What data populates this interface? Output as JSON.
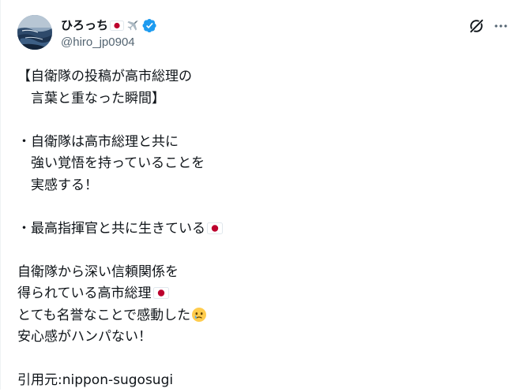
{
  "author": {
    "display_name": "ひろっち",
    "handle": "@hiro_jp0904",
    "verified": true,
    "name_emojis": [
      "flag-japan-icon",
      "airplane-icon"
    ]
  },
  "actions": {
    "grok_icon": "grok-icon",
    "more_icon": "more-options-icon"
  },
  "colors": {
    "text": "#0f1419",
    "secondary": "#536471",
    "verified": "#1d9bf0",
    "flag_red": "#bc002d"
  },
  "post": {
    "lines": [
      {
        "text": "【自衛隊の投稿が高市総理の",
        "emoji": ""
      },
      {
        "text": "　言葉と重なった瞬間】",
        "emoji": ""
      },
      {
        "text": "",
        "emoji": ""
      },
      {
        "text": "・自衛隊は高市総理と共に",
        "emoji": ""
      },
      {
        "text": "　強い覚悟を持っていることを",
        "emoji": ""
      },
      {
        "text": "　実感する！",
        "emoji": ""
      },
      {
        "text": "",
        "emoji": ""
      },
      {
        "text": "・最高指揮官と共に生きている",
        "emoji": "flag"
      },
      {
        "text": "",
        "emoji": ""
      },
      {
        "text": "自衛隊から深い信頼関係を",
        "emoji": ""
      },
      {
        "text": "得られている高市総理",
        "emoji": "flag"
      },
      {
        "text": "とても名誉なことで感動した",
        "emoji": "tear"
      },
      {
        "text": "安心感がハンパない！",
        "emoji": ""
      },
      {
        "text": "",
        "emoji": ""
      },
      {
        "text": "引用元:nippon-sugosugi",
        "emoji": ""
      }
    ]
  }
}
